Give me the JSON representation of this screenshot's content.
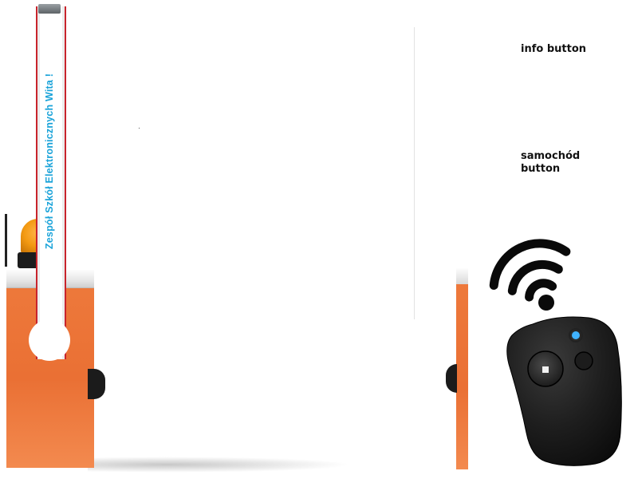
{
  "barrier": {
    "pole_text": "Zespół Szkół Elektronicznych Wita !"
  },
  "buttons": {
    "info_label": "info button",
    "car_label_line1": "samochód",
    "car_label_line2": "button"
  },
  "icons": {
    "signal": "wifi-icon",
    "remote": "remote-control-icon",
    "lamp": "warning-lamp-icon"
  },
  "colors": {
    "barrier_orange": "#ea7034",
    "pole_text": "#1aa3d9",
    "pole_stripe": "#c8242c",
    "lamp_amber": "#f39a12",
    "remote_body": "#1e1e1e",
    "led_blue": "#3fb2ff"
  }
}
